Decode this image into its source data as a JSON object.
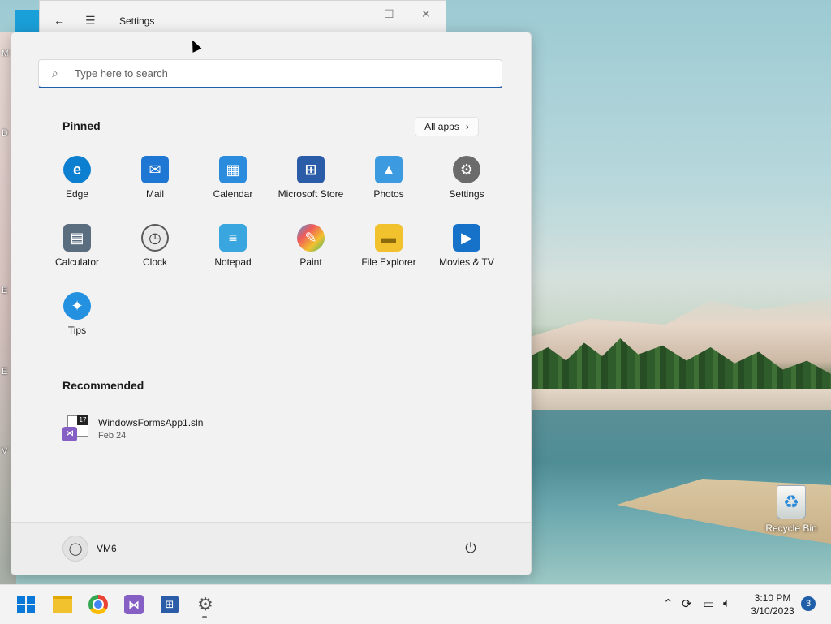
{
  "settings_window": {
    "title": "Settings"
  },
  "search": {
    "placeholder": "Type here to search"
  },
  "pinned": {
    "title": "Pinned",
    "all_apps_label": "All apps",
    "apps": [
      {
        "label": "Edge",
        "icon": "edge-icon",
        "color": "#0c7fd0"
      },
      {
        "label": "Mail",
        "icon": "mail-icon",
        "color": "#1f77d4"
      },
      {
        "label": "Calendar",
        "icon": "calendar-icon",
        "color": "#2b8bdd"
      },
      {
        "label": "Microsoft Store",
        "icon": "store-icon",
        "color": "#2a5ca7"
      },
      {
        "label": "Photos",
        "icon": "photos-icon",
        "color": "#3c9be0"
      },
      {
        "label": "Settings",
        "icon": "settings-gear-icon",
        "color": "#6b6b6b"
      },
      {
        "label": "Calculator",
        "icon": "calculator-icon",
        "color": "#5b6e80"
      },
      {
        "label": "Clock",
        "icon": "clock-icon",
        "color": "#5b5b5b"
      },
      {
        "label": "Notepad",
        "icon": "notepad-icon",
        "color": "#3aa6df"
      },
      {
        "label": "Paint",
        "icon": "paint-icon",
        "color": "#4d9be0"
      },
      {
        "label": "File Explorer",
        "icon": "file-explorer-icon",
        "color": "#f2c12e"
      },
      {
        "label": "Movies & TV",
        "icon": "movies-tv-icon",
        "color": "#1672c9"
      },
      {
        "label": "Tips",
        "icon": "tips-icon",
        "color": "#2490e0"
      }
    ]
  },
  "recommended": {
    "title": "Recommended",
    "items": [
      {
        "name": "WindowsFormsApp1.sln",
        "date": "Feb 24",
        "icon": "visual-studio-solution-icon",
        "badge": "17"
      }
    ]
  },
  "footer": {
    "user_name": "VM6"
  },
  "desktop": {
    "recycle_bin_label": "Recycle Bin"
  },
  "taskbar": {
    "apps": [
      "start-icon",
      "file-explorer-icon",
      "chrome-icon",
      "visual-studio-icon",
      "microsoft-store-icon",
      "settings-icon"
    ],
    "time": "3:10 PM",
    "date": "3/10/2023",
    "notification_count": "3"
  }
}
